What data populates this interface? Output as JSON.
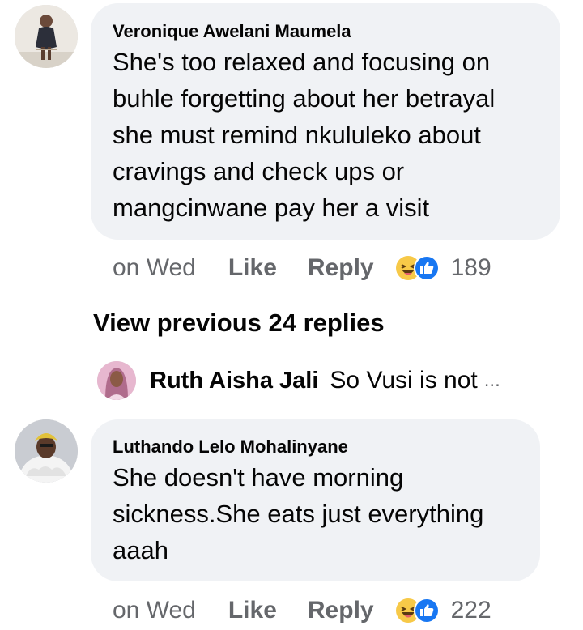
{
  "comments": [
    {
      "author": "Veronique Awelani Maumela",
      "text": "She's too relaxed and focusing on\nbuhle forgetting about her betrayal\nshe must remind nkululeko about\ncravings and check ups or\nmangcinwane  pay her a visit",
      "time": "on Wed",
      "like_label": "Like",
      "reply_label": "Reply",
      "reactions": [
        "haha-icon",
        "like-icon"
      ],
      "reaction_count": "189"
    },
    {
      "author": "Luthando Lelo Mohalinyane",
      "text": "She doesn't have morning\nsickness.She eats just everything\naaah",
      "time": "on Wed",
      "like_label": "Like",
      "reply_label": "Reply",
      "reactions": [
        "haha-icon",
        "like-icon"
      ],
      "reaction_count": "222"
    }
  ],
  "thread": {
    "view_previous_label": "View previous 24 replies",
    "collapsed_reply": {
      "author": "Ruth Aisha Jali",
      "preview": "So Vusi is not",
      "ellipsis": "..."
    }
  },
  "colors": {
    "bubble": "#f0f2f5",
    "meta_text": "#65676b",
    "like_blue": "#1877f2",
    "haha_yellow": "#f7c948"
  }
}
